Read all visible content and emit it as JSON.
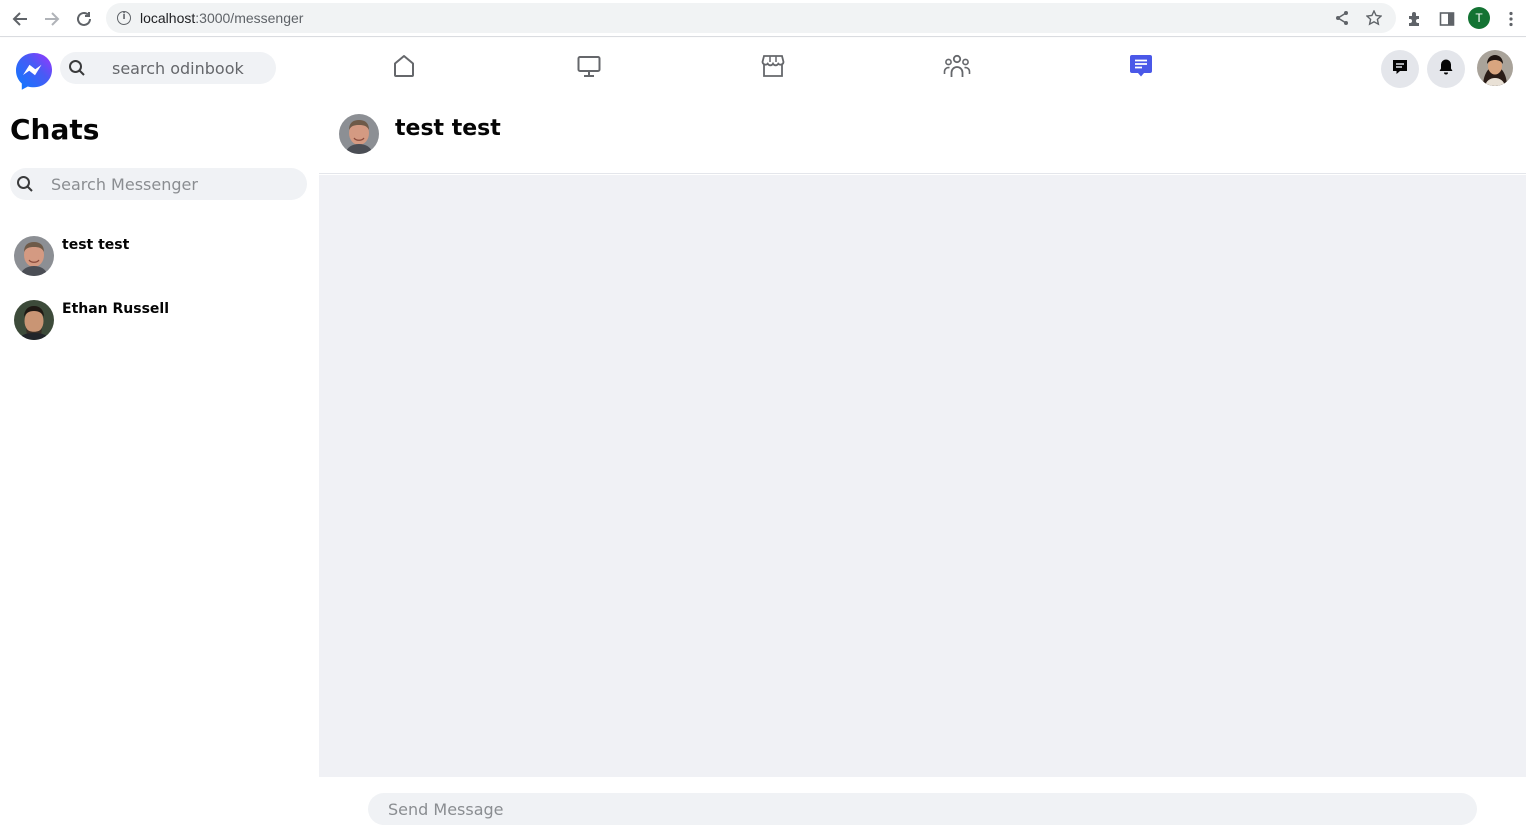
{
  "browser": {
    "url_host": "localhost",
    "url_path": ":3000/messenger",
    "profile_initial": "T"
  },
  "header": {
    "search_placeholder": "search odinbook",
    "tabs": [
      {
        "name": "home",
        "icon": "home-icon",
        "active": false
      },
      {
        "name": "watch",
        "icon": "monitor-icon",
        "active": false
      },
      {
        "name": "marketplace",
        "icon": "store-icon",
        "active": false
      },
      {
        "name": "groups",
        "icon": "people-icon",
        "active": false
      },
      {
        "name": "messenger",
        "icon": "chat-icon",
        "active": true
      }
    ],
    "active_color": "#4a58e8",
    "icon_color": "#65676b"
  },
  "sidebar": {
    "title": "Chats",
    "search_placeholder": "Search Messenger",
    "chats": [
      {
        "name": "test test"
      },
      {
        "name": "Ethan Russell"
      }
    ]
  },
  "conversation": {
    "title": "test test",
    "composer_placeholder": "Send Message"
  }
}
